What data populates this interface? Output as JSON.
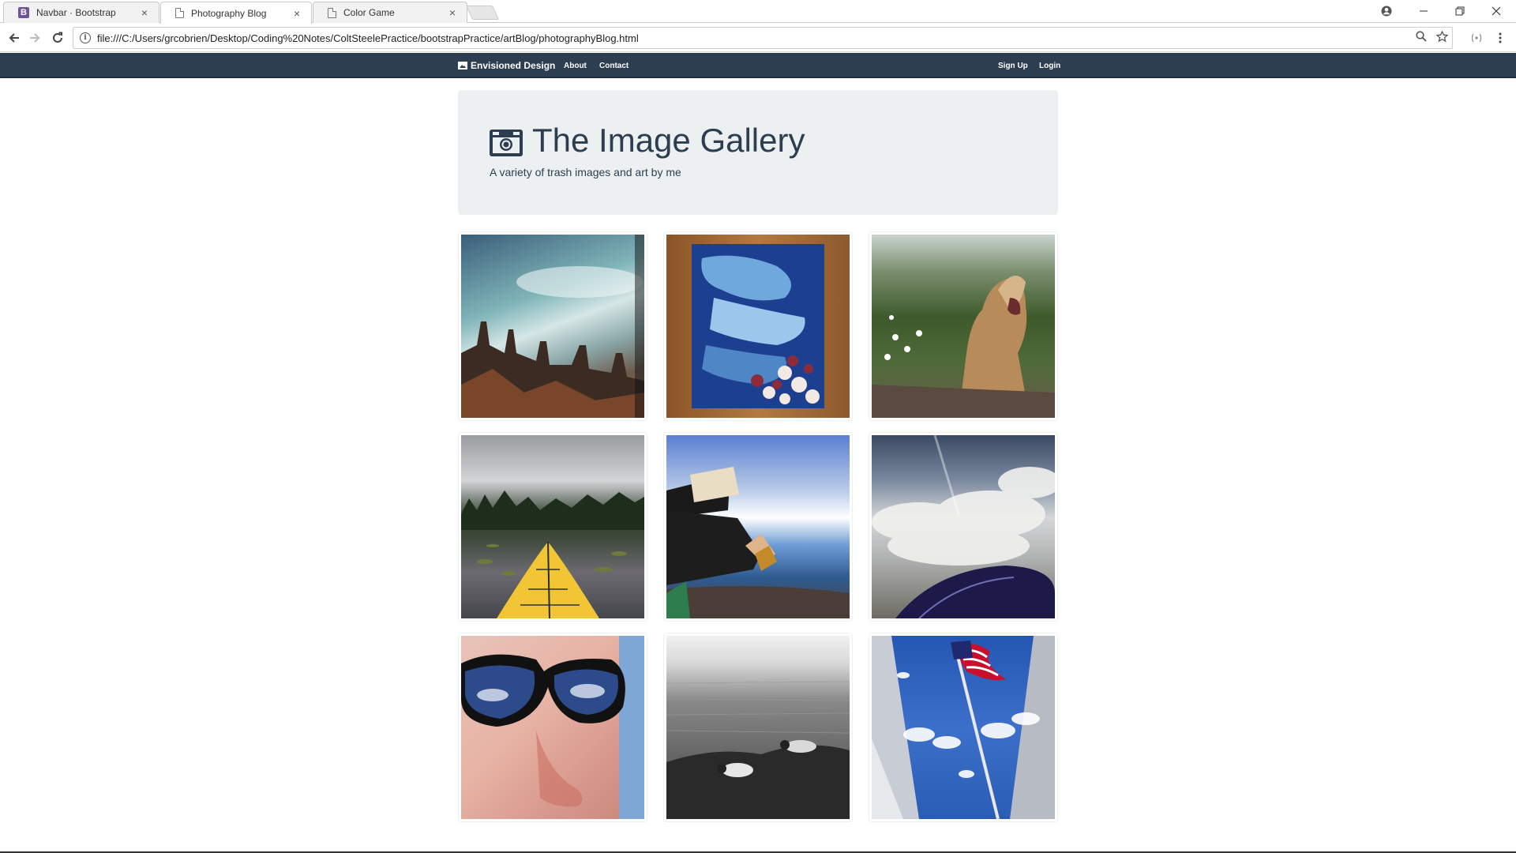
{
  "browser": {
    "tabs": [
      {
        "label": "Navbar · Bootstrap",
        "icon": "bootstrap-favicon-icon",
        "active": false
      },
      {
        "label": "Photography Blog",
        "icon": "document-icon",
        "active": true
      },
      {
        "label": "Color Game",
        "icon": "document-icon",
        "active": false
      }
    ],
    "close_glyph": "×",
    "bootstrap_letter": "B",
    "url": "file:///C:/Users/grcobrien/Desktop/Coding%20Notes/ColtSteelePractice/bootstrapPractice/artBlog/photographyBlog.html"
  },
  "navbar": {
    "brand": "Envisioned Design",
    "links": [
      "About",
      "Contact"
    ],
    "right_links": [
      "Sign Up",
      "Login"
    ],
    "background": "#2c3e50"
  },
  "jumbotron": {
    "title": "The Image Gallery",
    "subtitle": "A variety of trash images and art by me",
    "background": "#ecf0f1"
  },
  "gallery": {
    "images": [
      {
        "name": "castle-rooftops-photo"
      },
      {
        "name": "blue-painting-flowers-photo"
      },
      {
        "name": "yawning-dog-photo"
      },
      {
        "name": "kayak-lake-photo"
      },
      {
        "name": "reading-by-lake-photo"
      },
      {
        "name": "clouds-airplane-photo"
      },
      {
        "name": "sunglasses-selfie-photo"
      },
      {
        "name": "rocky-shore-bw-photo"
      },
      {
        "name": "american-flag-photo"
      }
    ]
  }
}
